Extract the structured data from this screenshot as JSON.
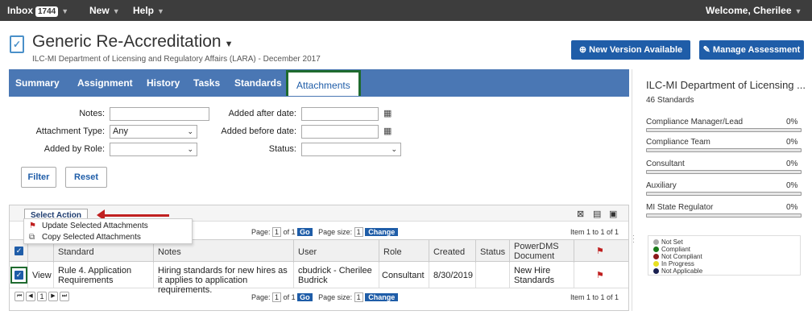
{
  "topbar": {
    "inbox_label": "Inbox",
    "inbox_count": "1744",
    "new_label": "New",
    "help_label": "Help",
    "welcome": "Welcome, Cherilee"
  },
  "header": {
    "title": "Generic Re-Accreditation",
    "subtitle": "ILC-MI Department of Licensing and Regulatory Affairs (LARA) - December 2017",
    "new_version_btn": "New Version Available",
    "manage_btn": "Manage Assessment"
  },
  "tabs": [
    "Summary",
    "Assignment",
    "History",
    "Tasks",
    "Standards",
    "Attachments"
  ],
  "active_tab": "Attachments",
  "filters": {
    "notes_label": "Notes:",
    "notes_value": "",
    "attachment_type_label": "Attachment Type:",
    "attachment_type_value": "Any",
    "added_by_role_label": "Added by Role:",
    "added_by_role_value": "",
    "added_after_label": "Added after date:",
    "added_after_value": "",
    "added_before_label": "Added before date:",
    "added_before_value": "",
    "status_label": "Status:",
    "status_value": "",
    "filter_btn": "Filter",
    "reset_btn": "Reset"
  },
  "grid": {
    "select_action_label": "Select Action",
    "menu_items": [
      "Update Selected Attachments",
      "Copy Selected Attachments"
    ],
    "page_label": "Page:",
    "page_value": "1",
    "of_label": "of 1",
    "go_label": "Go",
    "page_size_label": "Page size:",
    "page_size_value": "1",
    "change_label": "Change",
    "item_count": "Item 1 to 1 of 1",
    "columns": [
      "Standard",
      "Notes",
      "User",
      "Role",
      "Created",
      "Status",
      "PowerDMS Document"
    ],
    "rows": [
      {
        "action": "View",
        "standard": "Rule 4. Application Requirements",
        "notes": "Hiring standards for new hires as it applies to application requirements.",
        "user": "cbudrick - Cherilee Budrick",
        "role": "Consultant",
        "created": "8/30/2019",
        "status": "",
        "document": "New Hire Standards"
      }
    ],
    "current_page": "1"
  },
  "panel": {
    "title": "ILC-MI Department of Licensing ...",
    "standards_count": "46 Standards",
    "bars": [
      {
        "label": "Compliance Manager/Lead",
        "pct": "0%",
        "value": 0
      },
      {
        "label": "Compliance Team",
        "pct": "0%",
        "value": 0
      },
      {
        "label": "Consultant",
        "pct": "0%",
        "value": 0
      },
      {
        "label": "Auxiliary",
        "pct": "0%",
        "value": 0
      },
      {
        "label": "MI State Regulator",
        "pct": "0%",
        "value": 0
      }
    ],
    "legend": [
      {
        "label": "Not Set",
        "color": "#aaaaaa"
      },
      {
        "label": "Compliant",
        "color": "#1a7a1a"
      },
      {
        "label": "Not Compliant",
        "color": "#8b1a1a"
      },
      {
        "label": "In Progress",
        "color": "#e8e020"
      },
      {
        "label": "Not Applicable",
        "color": "#1a2050"
      }
    ]
  },
  "colors": {
    "topbar": "#3d3d3d",
    "tabbar": "#4a77b4",
    "primary_button": "#1f5da8",
    "active_tab_outline": "#1f6b2f",
    "annotation_arrow": "#c02020"
  }
}
